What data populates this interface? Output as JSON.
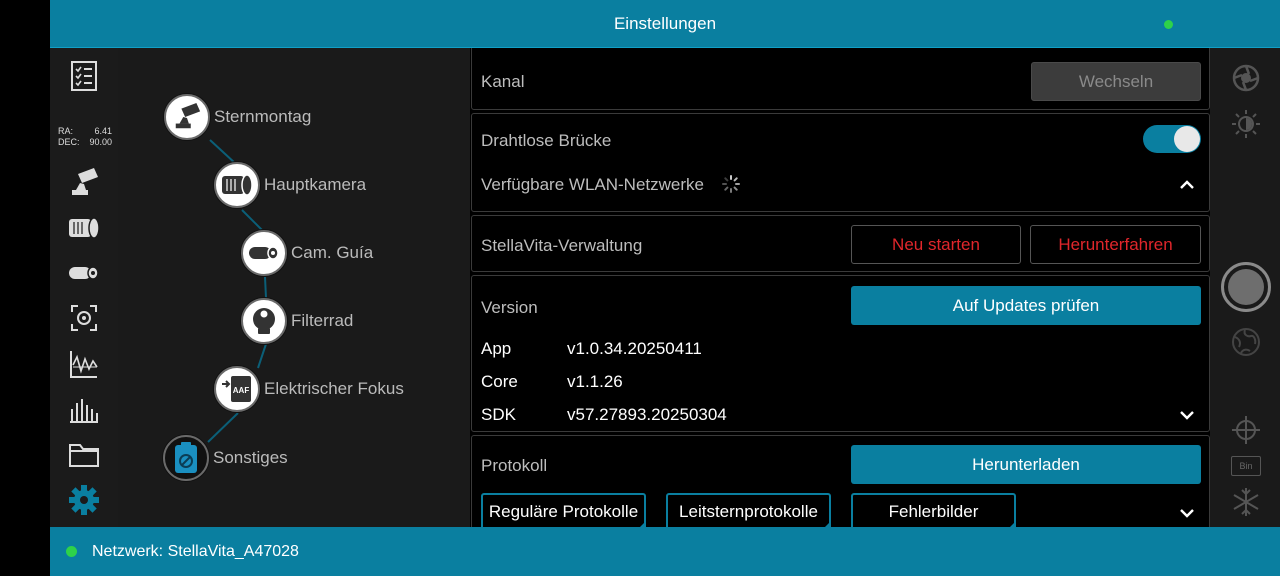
{
  "header": {
    "title": "Einstellungen"
  },
  "footer": {
    "network_label": "Netzwerk: StellaVita_A47028"
  },
  "sidebar": {
    "ra_label": "RA:",
    "ra_value": "6.41",
    "dec_label": "DEC:",
    "dec_value": "90.00",
    "icons": [
      "checklist-icon",
      "mount-icon",
      "main-camera-icon",
      "guide-camera-icon",
      "focus-target-icon",
      "graph-icon",
      "histogram-icon",
      "folder-icon",
      "settings-gear-icon"
    ]
  },
  "device_tree": {
    "items": [
      {
        "label": "Sternmontag",
        "icon": "mount-icon"
      },
      {
        "label": "Hauptkamera",
        "icon": "main-camera-icon"
      },
      {
        "label": "Cam. Guía",
        "icon": "guide-camera-icon"
      },
      {
        "label": "Filterrad",
        "icon": "filter-wheel-icon"
      },
      {
        "label": "Elektrischer Fokus",
        "icon": "focuser-icon"
      },
      {
        "label": "Sonstiges",
        "icon": "misc-icon"
      }
    ],
    "focuser_badge": "AAF"
  },
  "settings": {
    "channel": {
      "label": "Kanal",
      "button": "Wechseln"
    },
    "wireless": {
      "label": "Drahtlose Brücke",
      "enabled": true,
      "networks_label": "Verfügbare WLAN-Netzwerke"
    },
    "management": {
      "label": "StellaVita-Verwaltung",
      "restart": "Neu starten",
      "shutdown": "Herunterfahren"
    },
    "version": {
      "label": "Version",
      "update_button": "Auf Updates prüfen",
      "rows": [
        {
          "name": "App",
          "value": "v1.0.34.20250411"
        },
        {
          "name": "Core",
          "value": "v1.1.26"
        },
        {
          "name": "SDK",
          "value": "v57.27893.20250304"
        }
      ]
    },
    "log": {
      "label": "Protokoll",
      "download_button": "Herunterladen",
      "filters": [
        "Reguläre Protokolle",
        "Leitsternprotokolle",
        "Fehlerbilder"
      ]
    }
  },
  "right_toolbar": {
    "bin_label": "Bin",
    "icons": [
      "aperture-icon",
      "brightness-icon",
      "shutter-button",
      "globe-icon",
      "crosshair-icon",
      "bin-icon",
      "snowflake-icon"
    ]
  },
  "colors": {
    "accent": "#0a7fa0",
    "status_ok": "#2ed24a",
    "danger": "#e0262b"
  }
}
